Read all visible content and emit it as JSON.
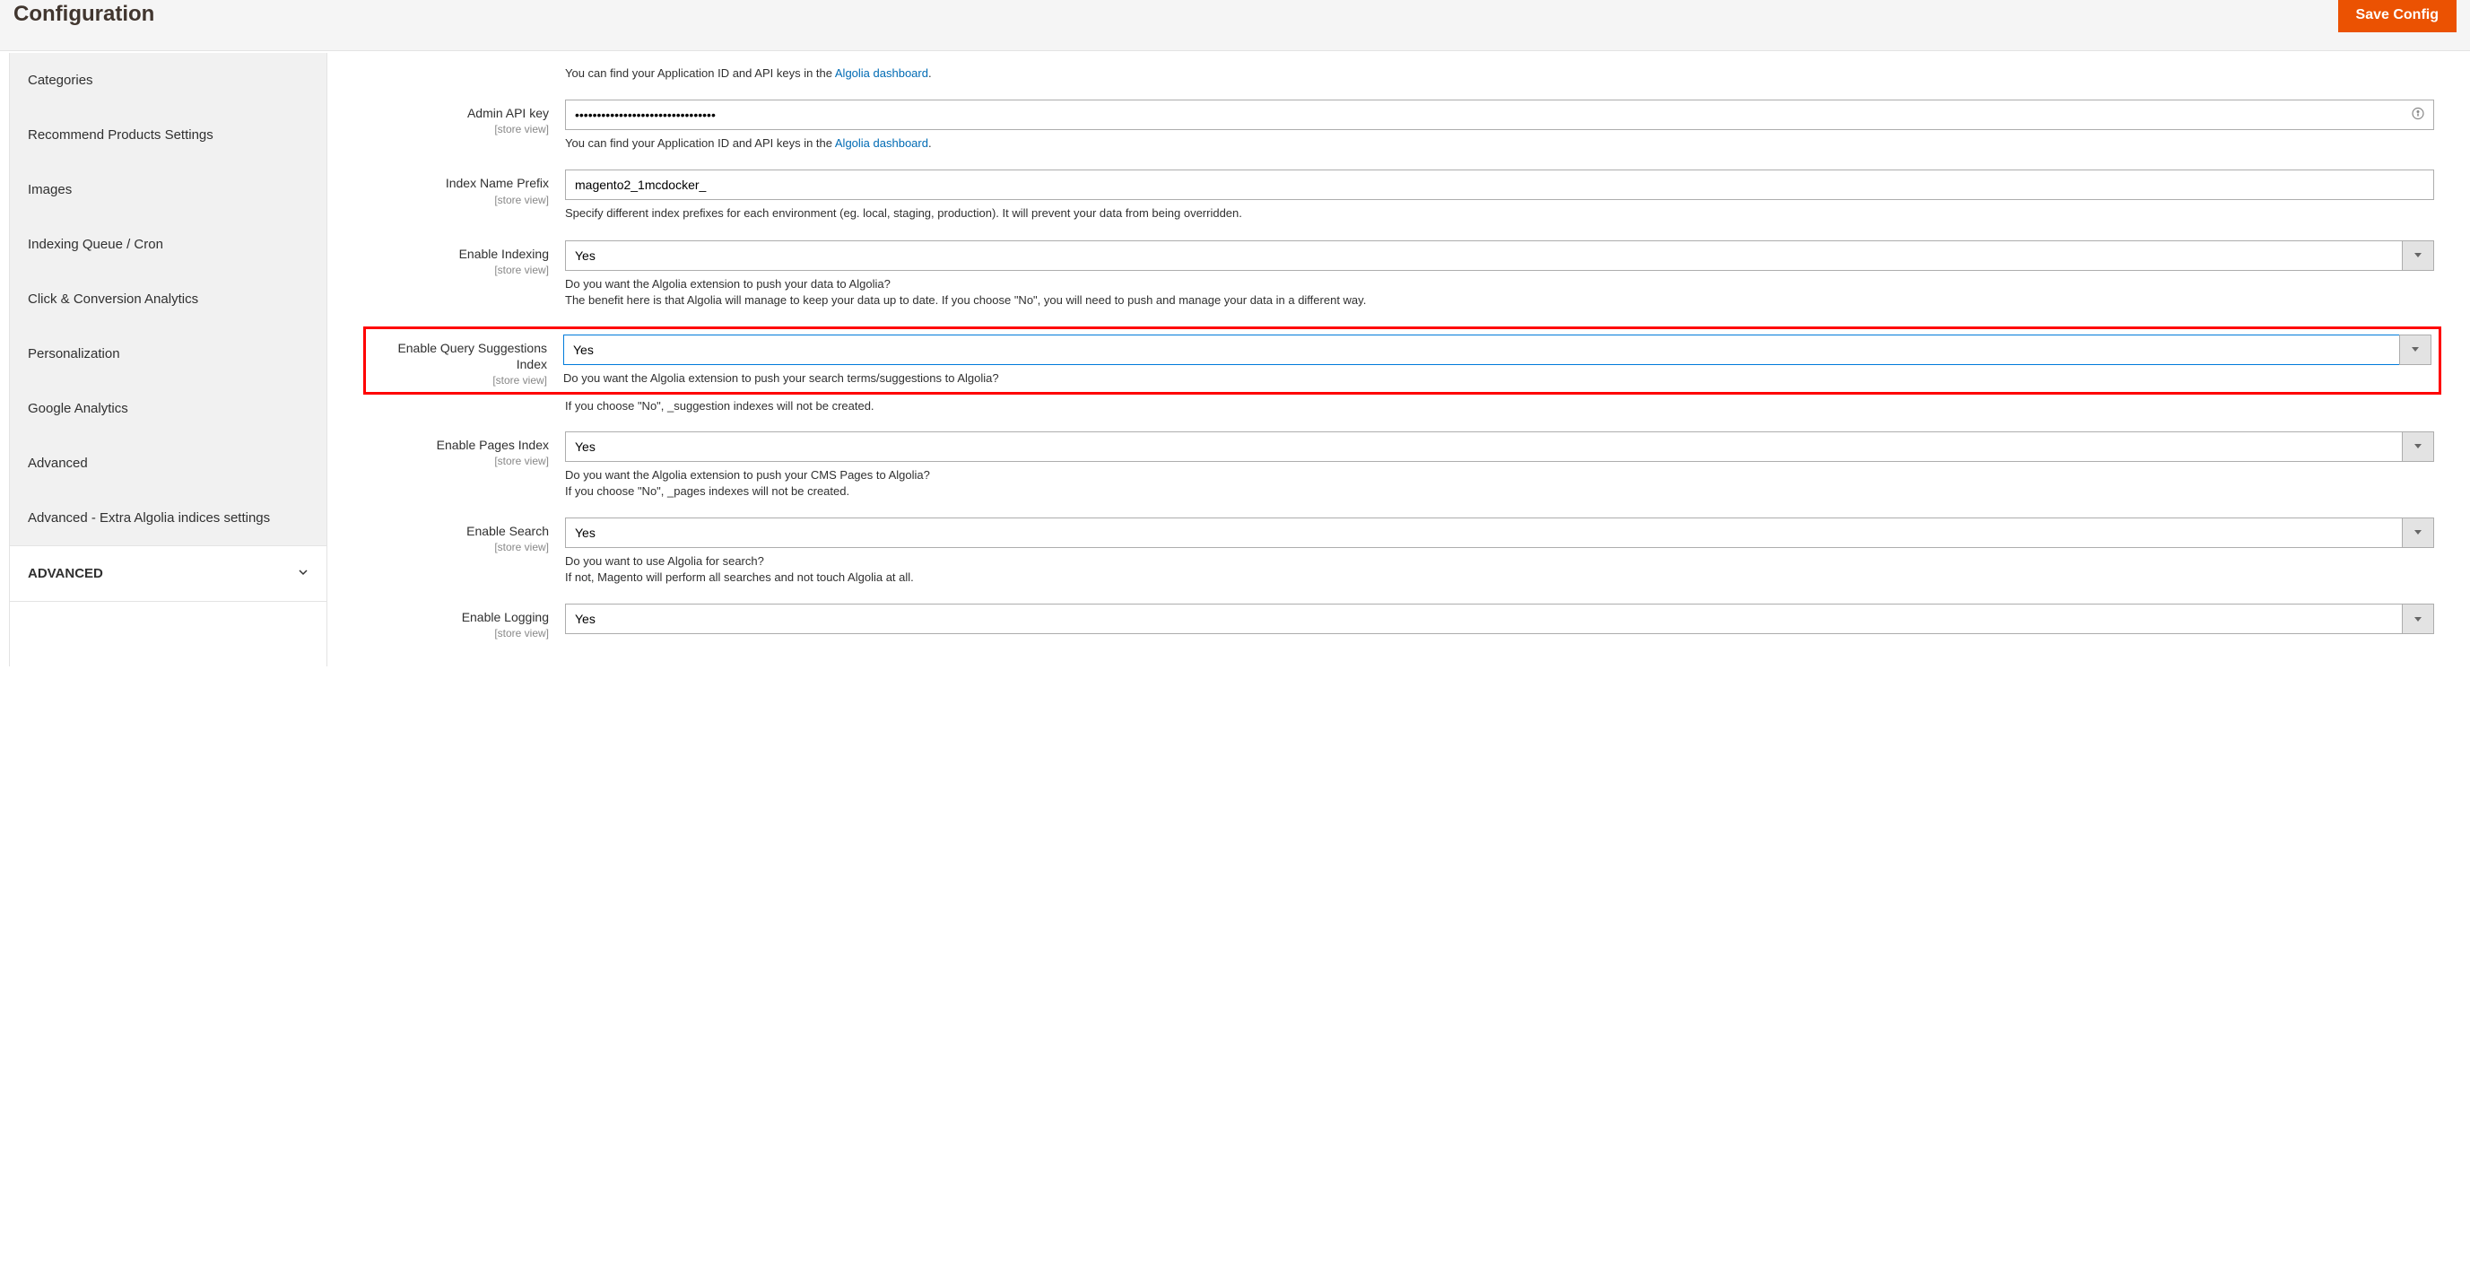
{
  "header": {
    "title": "Configuration",
    "save_label": "Save Config"
  },
  "sidebar": {
    "items": [
      "Categories",
      "Recommend Products Settings",
      "Images",
      "Indexing Queue / Cron",
      "Click & Conversion Analytics",
      "Personalization",
      "Google Analytics",
      "Advanced",
      "Advanced - Extra Algolia indices settings"
    ],
    "section": "ADVANCED"
  },
  "scope_label": "[store view]",
  "fields": {
    "app_id_help": {
      "text": "You can find your Application ID and API keys in the ",
      "link": "Algolia dashboard",
      "suffix": "."
    },
    "admin_api": {
      "label": "Admin API key",
      "value": "••••••••••••••••••••••••••••••••",
      "help_text": "You can find your Application ID and API keys in the ",
      "help_link": "Algolia dashboard",
      "help_suffix": "."
    },
    "prefix": {
      "label": "Index Name Prefix",
      "value": "magento2_1mcdocker_",
      "help": "Specify different index prefixes for each environment (eg. local, staging, production). It will prevent your data from being overridden."
    },
    "indexing": {
      "label": "Enable Indexing",
      "value": "Yes",
      "help1": "Do you want the Algolia extension to push your data to Algolia?",
      "help2": "The benefit here is that Algolia will manage to keep your data up to date. If you choose \"No\", you will need to push and manage your data in a different way."
    },
    "suggestions": {
      "label": "Enable Query Suggestions Index",
      "value": "Yes",
      "help1": "Do you want the Algolia extension to push your search terms/suggestions to Algolia?",
      "help2": "If you choose \"No\", _suggestion indexes will not be created."
    },
    "pages": {
      "label": "Enable Pages Index",
      "value": "Yes",
      "help1": "Do you want the Algolia extension to push your CMS Pages to Algolia?",
      "help2": "If you choose \"No\", _pages indexes will not be created."
    },
    "search": {
      "label": "Enable Search",
      "value": "Yes",
      "help1": "Do you want to use Algolia for search?",
      "help2": "If not, Magento will perform all searches and not touch Algolia at all."
    },
    "logging": {
      "label": "Enable Logging",
      "value": "Yes"
    }
  }
}
